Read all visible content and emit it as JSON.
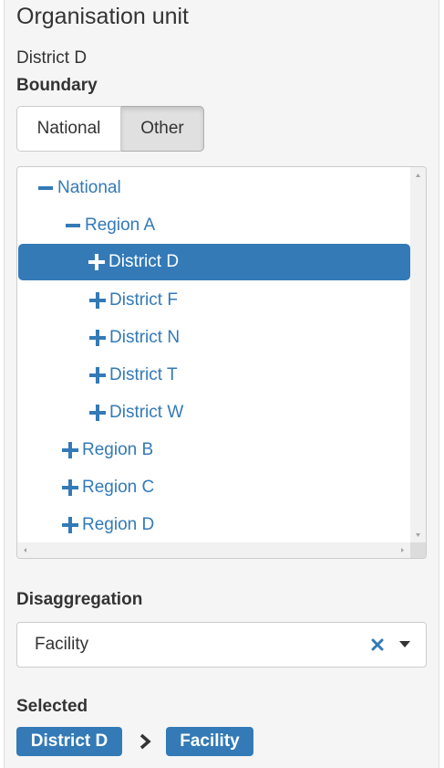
{
  "header": {
    "title": "Organisation unit",
    "selected_unit": "District D"
  },
  "boundary": {
    "label": "Boundary",
    "options": [
      "National",
      "Other"
    ],
    "active": "Other"
  },
  "tree": {
    "nodes": [
      {
        "label": "National",
        "state": "expanded",
        "level": 0
      },
      {
        "label": "Region A",
        "state": "expanded",
        "level": 1
      },
      {
        "label": "District D",
        "state": "collapsed",
        "level": 2,
        "selected": true
      },
      {
        "label": "District F",
        "state": "collapsed",
        "level": 2
      },
      {
        "label": "District N",
        "state": "collapsed",
        "level": 2
      },
      {
        "label": "District T",
        "state": "collapsed",
        "level": 2
      },
      {
        "label": "District W",
        "state": "collapsed",
        "level": 2
      },
      {
        "label": "Region B",
        "state": "collapsed",
        "level": 1
      },
      {
        "label": "Region C",
        "state": "collapsed",
        "level": 1
      },
      {
        "label": "Region D",
        "state": "collapsed",
        "level": 1
      }
    ]
  },
  "disaggregation": {
    "label": "Disaggregation",
    "value": "Facility",
    "clear_icon": "close-icon",
    "dropdown_icon": "caret-down-icon"
  },
  "selected": {
    "label": "Selected",
    "path": [
      "District D",
      "Facility"
    ],
    "separator_icon": "chevron-right-icon"
  },
  "colors": {
    "accent": "#337ab7",
    "panel_bg": "#f5f5f5"
  }
}
